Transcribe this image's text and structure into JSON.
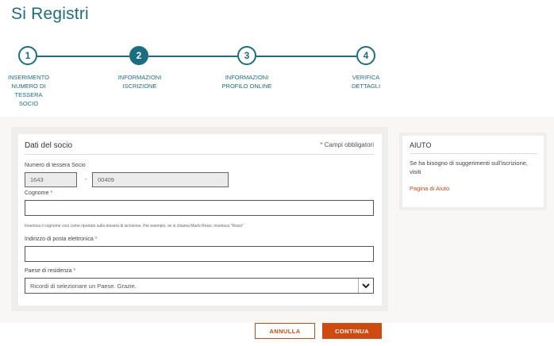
{
  "page": {
    "title": "Si Registri"
  },
  "steps": [
    {
      "number": "1",
      "label_lines": [
        "INSERIMENTO",
        "NUMERO DI",
        "TESSERA",
        "SOCIO"
      ],
      "active": false
    },
    {
      "number": "2",
      "label_lines": [
        "INFORMAZIONI",
        "ISCRIZIONE"
      ],
      "active": true
    },
    {
      "number": "3",
      "label_lines": [
        "INFORMAZIONI",
        "PROFILO ONLINE"
      ],
      "active": false
    },
    {
      "number": "4",
      "label_lines": [
        "VERIFICA",
        "DETTAGLI"
      ],
      "active": false
    }
  ],
  "form": {
    "heading": "Dati del socio",
    "required_star": "*",
    "required_note": "Campi obbligatori",
    "card_number": {
      "label": "Numero di tessera Socio",
      "part1": "1643",
      "separator": "-",
      "part2": "00409"
    },
    "surname": {
      "label": "Cognome",
      "value": "",
      "hint": "Inserisca il cognome così come riportato sulla tessera di iscrizione. Per esempio, se si chiama Mario Rossi, inserisca \"Rossi\""
    },
    "email": {
      "label": "Indirizzo di posta elettronica",
      "value": ""
    },
    "country": {
      "label": "Paese di residenza",
      "placeholder": "Ricordi di selezionare un Paese. Grazie."
    }
  },
  "help": {
    "title": "AIUTO",
    "text": "Se ha bisogno di suggerimenti sull'iscrizione, visiti",
    "link": "Pagina di Aiuto"
  },
  "buttons": {
    "cancel": "ANNULLA",
    "continue": "CONTINUA"
  },
  "colors": {
    "teal": "#1a6e80",
    "accent": "#d04a10"
  }
}
